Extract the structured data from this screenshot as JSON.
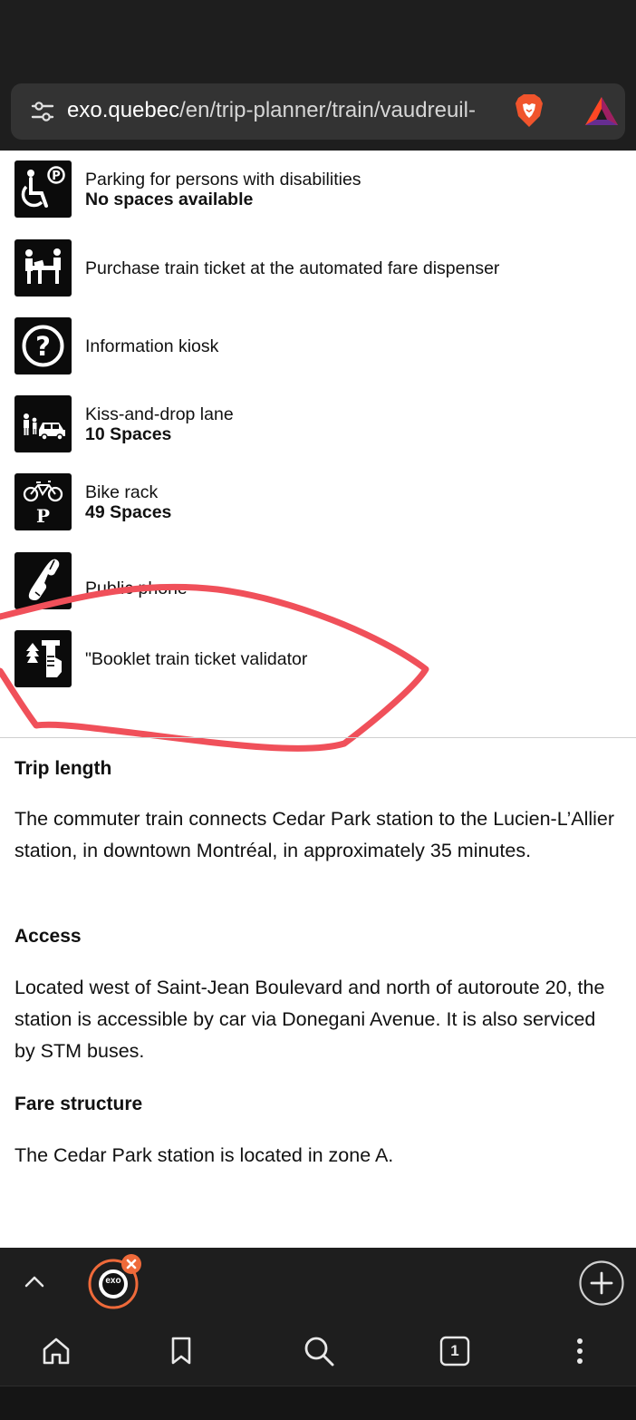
{
  "browser": {
    "url_host": "exo.quebec",
    "url_path": "/en/trip-planner/train/vaudreuil-",
    "tab_count": "1",
    "tab_favicon_text": "exo"
  },
  "amenities": [
    {
      "label": "Parking for persons with disabilities",
      "sub": "No spaces available",
      "icon": "wheelchair-parking-icon"
    },
    {
      "label": "Purchase train ticket at the automated fare dispenser",
      "sub": "",
      "icon": "ticket-counter-icon"
    },
    {
      "label": "Information kiosk",
      "sub": "",
      "icon": "question-mark-icon"
    },
    {
      "label": "Kiss-and-drop lane",
      "sub": "10 Spaces",
      "icon": "kiss-and-drop-icon"
    },
    {
      "label": "Bike rack",
      "sub": "49 Spaces",
      "icon": "bike-parking-icon"
    },
    {
      "label": "Public phone",
      "sub": "",
      "icon": "phone-icon"
    },
    {
      "label": "\"Booklet train ticket validator",
      "sub": "",
      "icon": "ticket-validator-icon"
    }
  ],
  "sections": [
    {
      "title": "Trip length",
      "body": "The commuter train connects Cedar Park station to the Lucien-L’Allier station, in downtown Montréal, in approximately 35 minutes."
    },
    {
      "title": "Access",
      "body": "Located west of Saint-Jean Boulevard and north of autoroute 20, the station is accessible by car via Donegani Avenue. It is also serviced by STM buses."
    },
    {
      "title": "Fare structure",
      "body": "The Cedar Park station is located in zone A."
    }
  ],
  "colors": {
    "chrome": "#1e1e1e",
    "annotation": "#f0505a",
    "exo_orange": "#ef6a3a"
  }
}
